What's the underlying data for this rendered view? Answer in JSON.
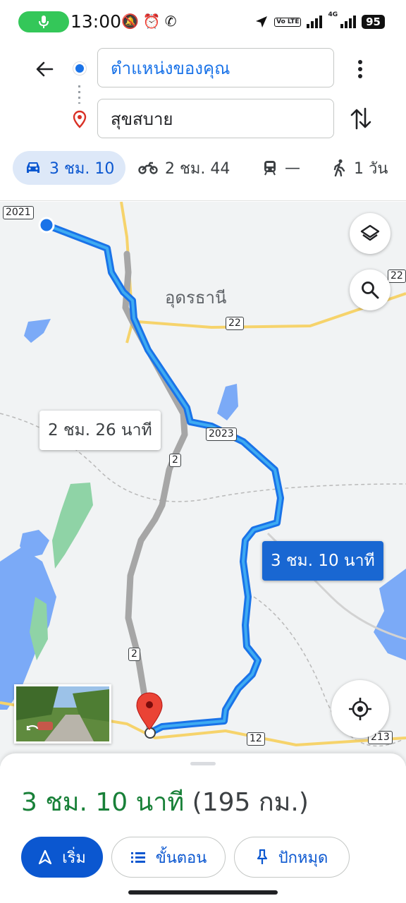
{
  "status_bar": {
    "time": "13:00",
    "left_icons": "🔕⏰✆",
    "network": "4G",
    "volte": "Vo LTE",
    "battery": "95"
  },
  "search": {
    "origin": "ตำแหน่งของคุณ",
    "destination": "สุขสบาย"
  },
  "modes": {
    "car": "3 ชม. 10",
    "motorcycle": "2 ชม. 44",
    "transit": "—",
    "walk": "1 วัน"
  },
  "map": {
    "place_label": "อุดรธานี",
    "alt_route_label": "2 ชม. 26 นาที",
    "main_route_label": "3 ชม. 10 นาที",
    "road_shields": {
      "r2021": "2021",
      "r22_top": "22",
      "r22_mid": "22",
      "r2023": "2023",
      "r2_top": "2",
      "r2_bottom": "2",
      "r12": "12",
      "r213": "213"
    }
  },
  "summary": {
    "duration": "3 ชม. 10 นาที",
    "distance": "(195 กม.)"
  },
  "actions": {
    "start": "เริ่ม",
    "steps": "ขั้นตอน",
    "pin": "ปักหมุด"
  },
  "colors": {
    "route_primary": "#1a73e8",
    "route_alt": "#a6a6a6",
    "duration_text": "#188038",
    "accent": "#0b57d0"
  }
}
